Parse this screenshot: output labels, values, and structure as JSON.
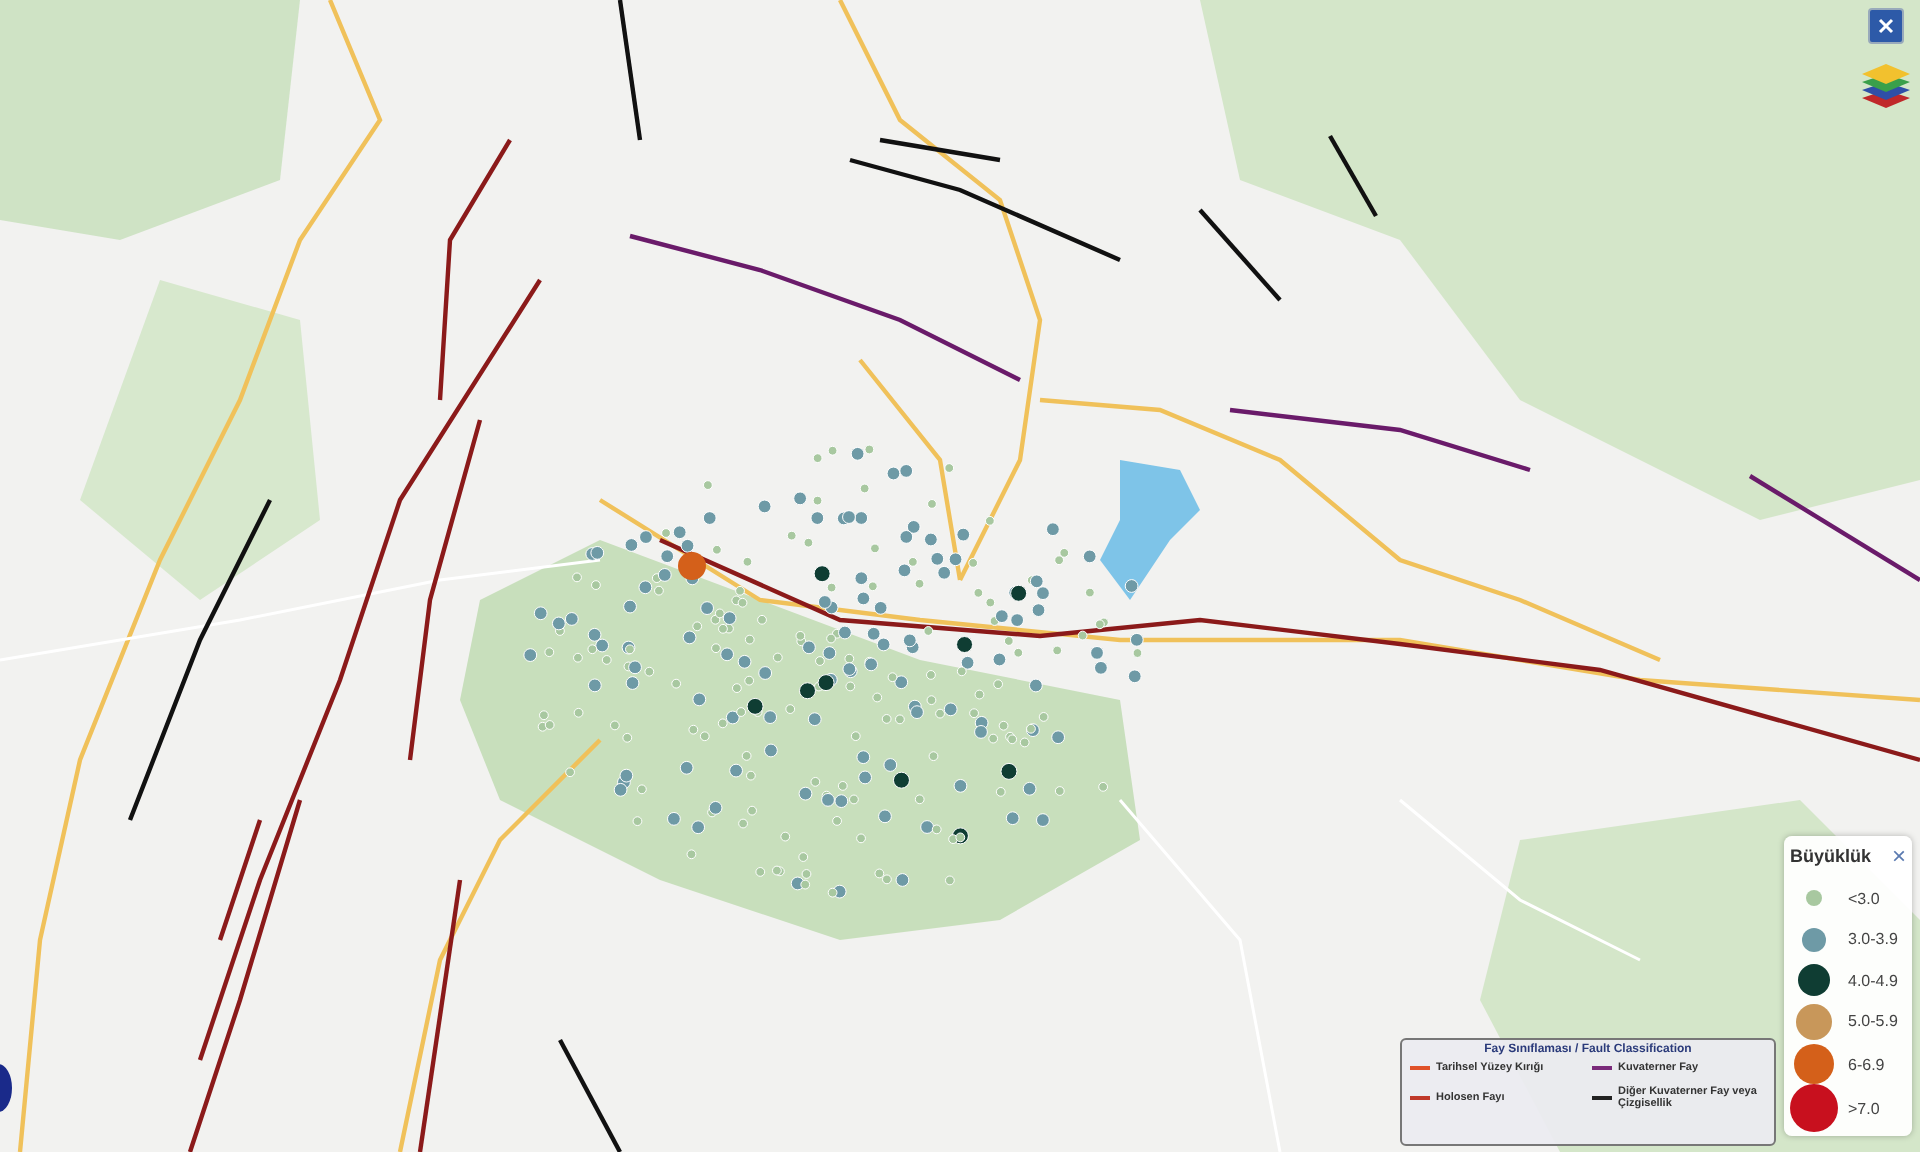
{
  "legend": {
    "title": "Büyüklük",
    "close": "×",
    "items": [
      {
        "label": "<3.0",
        "color": "#a8c8a0"
      },
      {
        "label": "3.0-3.9",
        "color": "#6e9aa6"
      },
      {
        "label": "4.0-4.9",
        "color": "#0f3d33"
      },
      {
        "label": "5.0-5.9",
        "color": "#c8975a"
      },
      {
        "label": "6-6.9",
        "color": "#d4601a"
      },
      {
        "label": ">7.0",
        "color": "#c8101e"
      }
    ]
  },
  "fault_legend": {
    "title": "Fay Sınıflaması / Fault Classification",
    "items": [
      {
        "label": "Tarihsel Yüzey Kırığı",
        "color": "#e0522a"
      },
      {
        "label": "Kuvaterner Fay",
        "color": "#7a2a7a"
      },
      {
        "label": "Holosen Fayı",
        "color": "#c0392b"
      },
      {
        "label": "Diğer Kuvaterner Fay veya Çizgisellik",
        "color": "#222222"
      }
    ]
  }
}
